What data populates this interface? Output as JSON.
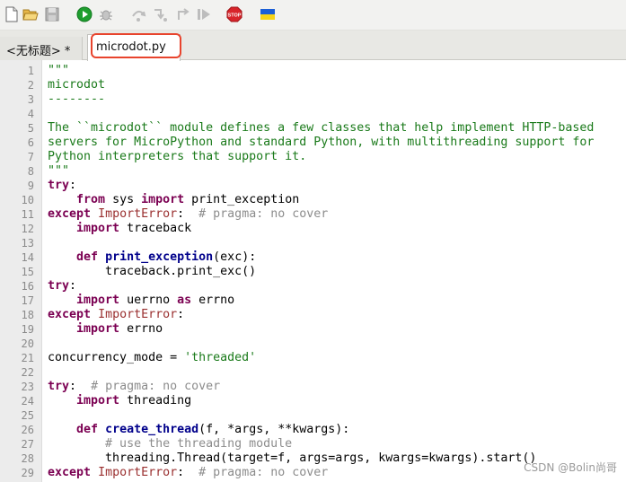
{
  "toolbar": {
    "buttons": [
      {
        "name": "new-file-icon"
      },
      {
        "name": "open-folder-icon"
      },
      {
        "name": "save-icon"
      },
      {
        "name": "run-icon"
      },
      {
        "name": "debug-icon"
      },
      {
        "name": "step-over-icon"
      },
      {
        "name": "step-into-icon"
      },
      {
        "name": "step-out-icon"
      },
      {
        "name": "resume-icon"
      },
      {
        "name": "stop-icon",
        "label": "STOP"
      },
      {
        "name": "ukraine-flag-icon"
      }
    ]
  },
  "tabs": {
    "untitled": "<无标题> *",
    "active": "microdot.py"
  },
  "colors": {
    "keyword": "#7b0052",
    "definition": "#00008b",
    "string": "#1a7a1a",
    "comment": "#8c8c8c",
    "builtin": "#9a2f2f",
    "highlight_border": "#e8442d",
    "run_green": "#1f9e2f",
    "stop_red": "#d8242a"
  },
  "editor": {
    "lines": [
      {
        "n": "1",
        "tokens": [
          [
            "string",
            "\"\"\""
          ]
        ]
      },
      {
        "n": "2",
        "tokens": [
          [
            "string",
            "microdot"
          ]
        ]
      },
      {
        "n": "3",
        "tokens": [
          [
            "string",
            "--------"
          ]
        ]
      },
      {
        "n": "4",
        "tokens": []
      },
      {
        "n": "5",
        "tokens": [
          [
            "string",
            "The ``microdot`` module defines a few classes that help implement HTTP-based"
          ]
        ]
      },
      {
        "n": "6",
        "tokens": [
          [
            "string",
            "servers for MicroPython and standard Python, with multithreading support for"
          ]
        ]
      },
      {
        "n": "7",
        "tokens": [
          [
            "string",
            "Python interpreters that support it."
          ]
        ]
      },
      {
        "n": "8",
        "tokens": [
          [
            "string",
            "\"\"\""
          ]
        ]
      },
      {
        "n": "9",
        "tokens": [
          [
            "keyword",
            "try"
          ],
          [
            "plain",
            ":"
          ]
        ]
      },
      {
        "n": "10",
        "tokens": [
          [
            "plain",
            "    "
          ],
          [
            "keyword",
            "from"
          ],
          [
            "plain",
            " sys "
          ],
          [
            "keyword",
            "import"
          ],
          [
            "plain",
            " print_exception"
          ]
        ]
      },
      {
        "n": "11",
        "tokens": [
          [
            "keyword",
            "except"
          ],
          [
            "plain",
            " "
          ],
          [
            "builtin",
            "ImportError"
          ],
          [
            "plain",
            ":  "
          ],
          [
            "comment",
            "# pragma: no cover"
          ]
        ]
      },
      {
        "n": "12",
        "tokens": [
          [
            "plain",
            "    "
          ],
          [
            "keyword",
            "import"
          ],
          [
            "plain",
            " traceback"
          ]
        ]
      },
      {
        "n": "13",
        "tokens": []
      },
      {
        "n": "14",
        "tokens": [
          [
            "plain",
            "    "
          ],
          [
            "keyword",
            "def"
          ],
          [
            "plain",
            " "
          ],
          [
            "def",
            "print_exception"
          ],
          [
            "plain",
            "(exc):"
          ]
        ]
      },
      {
        "n": "15",
        "tokens": [
          [
            "plain",
            "        traceback.print_exc()"
          ]
        ]
      },
      {
        "n": "16",
        "tokens": [
          [
            "keyword",
            "try"
          ],
          [
            "plain",
            ":"
          ]
        ]
      },
      {
        "n": "17",
        "tokens": [
          [
            "plain",
            "    "
          ],
          [
            "keyword",
            "import"
          ],
          [
            "plain",
            " uerrno "
          ],
          [
            "keyword",
            "as"
          ],
          [
            "plain",
            " errno"
          ]
        ]
      },
      {
        "n": "18",
        "tokens": [
          [
            "keyword",
            "except"
          ],
          [
            "plain",
            " "
          ],
          [
            "builtin",
            "ImportError"
          ],
          [
            "plain",
            ":"
          ]
        ]
      },
      {
        "n": "19",
        "tokens": [
          [
            "plain",
            "    "
          ],
          [
            "keyword",
            "import"
          ],
          [
            "plain",
            " errno"
          ]
        ]
      },
      {
        "n": "20",
        "tokens": []
      },
      {
        "n": "21",
        "tokens": [
          [
            "plain",
            "concurrency_mode = "
          ],
          [
            "string",
            "'threaded'"
          ]
        ]
      },
      {
        "n": "22",
        "tokens": []
      },
      {
        "n": "23",
        "tokens": [
          [
            "keyword",
            "try"
          ],
          [
            "plain",
            ":  "
          ],
          [
            "comment",
            "# pragma: no cover"
          ]
        ]
      },
      {
        "n": "24",
        "tokens": [
          [
            "plain",
            "    "
          ],
          [
            "keyword",
            "import"
          ],
          [
            "plain",
            " threading"
          ]
        ]
      },
      {
        "n": "25",
        "tokens": []
      },
      {
        "n": "26",
        "tokens": [
          [
            "plain",
            "    "
          ],
          [
            "keyword",
            "def"
          ],
          [
            "plain",
            " "
          ],
          [
            "def",
            "create_thread"
          ],
          [
            "plain",
            "(f, *args, **kwargs):"
          ]
        ]
      },
      {
        "n": "27",
        "tokens": [
          [
            "plain",
            "        "
          ],
          [
            "comment",
            "# use the threading module"
          ]
        ]
      },
      {
        "n": "28",
        "tokens": [
          [
            "plain",
            "        threading.Thread(target=f, args=args, kwargs=kwargs).start()"
          ]
        ]
      },
      {
        "n": "29",
        "tokens": [
          [
            "keyword",
            "except"
          ],
          [
            "plain",
            " "
          ],
          [
            "builtin",
            "ImportError"
          ],
          [
            "plain",
            ":  "
          ],
          [
            "comment",
            "# pragma: no cover"
          ]
        ]
      }
    ]
  },
  "watermark": "CSDN @Bolin尚哥"
}
